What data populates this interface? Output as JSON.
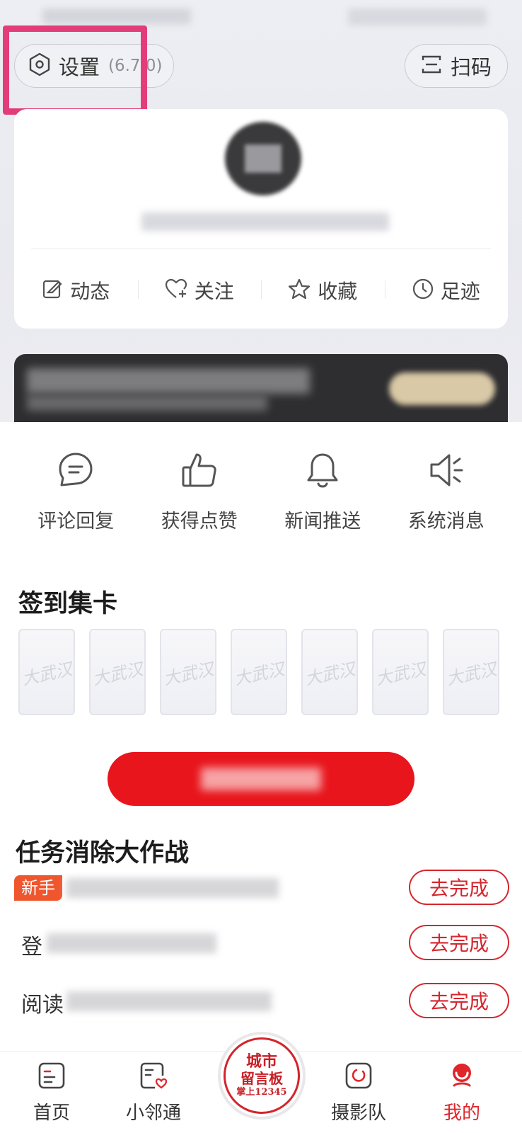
{
  "header": {
    "settings_label": "设置",
    "settings_version": "(6.7.0)",
    "scan_label": "扫码"
  },
  "profile": {
    "actions": [
      "动态",
      "关注",
      "收藏",
      "足迹"
    ]
  },
  "messages": {
    "items": [
      "评论回复",
      "获得点赞",
      "新闻推送",
      "系统消息"
    ]
  },
  "checkin": {
    "title": "签到集卡",
    "card_watermark": "大武汉",
    "card_count": 7
  },
  "tasks": {
    "title": "任务消除大作战",
    "items": [
      {
        "badge": "新手",
        "text": "",
        "button": "去完成"
      },
      {
        "badge": "",
        "text": "登",
        "button": "去完成"
      },
      {
        "badge": "",
        "text": "阅读",
        "button": "去完成"
      }
    ]
  },
  "bottom_nav": {
    "items": [
      "首页",
      "小邻通",
      "摄影队",
      "我的"
    ],
    "center": {
      "line1": "城市",
      "line2": "留言板",
      "line3": "掌上12345"
    },
    "active_index": 3
  },
  "colors": {
    "accent_red": "#e8151c",
    "highlight_pink": "#e33d79",
    "badge_orange": "#f0562e"
  }
}
